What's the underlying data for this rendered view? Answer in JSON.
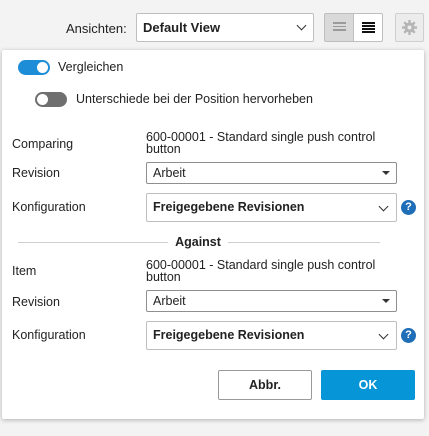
{
  "toolbar": {
    "views_label": "Ansichten:",
    "views_value": "Default View"
  },
  "panel": {
    "compare_toggle": {
      "label": "Vergleichen",
      "on": true
    },
    "highlight_toggle": {
      "label": "Unterschiede bei der Position hervorheben",
      "on": false
    },
    "comparing": {
      "label": "Comparing",
      "item_name": "600-00001 - Standard single push control button",
      "revision_label": "Revision",
      "revision_value": "Arbeit",
      "config_label": "Konfiguration",
      "config_value": "Freigegebene Revisionen"
    },
    "against_label": "Against",
    "against": {
      "label": "Item",
      "item_name": "600-00001 - Standard single push control button",
      "revision_label": "Revision",
      "revision_value": "Arbeit",
      "config_label": "Konfiguration",
      "config_value": "Freigegebene Revisionen"
    },
    "help_glyph": "?",
    "cancel_label": "Abbr.",
    "ok_label": "OK"
  },
  "colors": {
    "accent": "#0696d7",
    "toggle_on": "#1e8dd8",
    "toggle_off": "#6f6f6f",
    "help": "#1f6fb8"
  },
  "icons": {
    "views_dropdown": "chevron-down-icon",
    "list_view": "list-view-icon",
    "compact_view": "compact-list-icon",
    "settings": "gear-icon",
    "help": "help-circle-icon"
  }
}
